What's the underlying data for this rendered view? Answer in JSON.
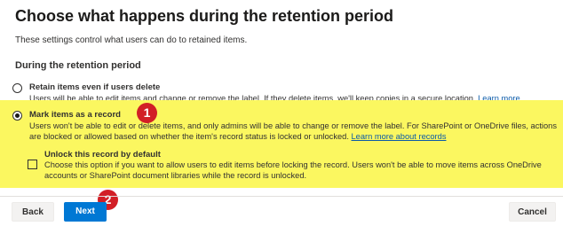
{
  "page": {
    "title": "Choose what happens during the retention period",
    "description": "These settings control what users can do to retained items.",
    "section_heading": "During the retention period"
  },
  "options": {
    "retain": {
      "label": "Retain items even if users delete",
      "description": "Users will be able to edit items and change or remove the label. If they delete items, we'll keep copies in a secure location.",
      "link": "Learn more",
      "selected": false
    },
    "record": {
      "label": "Mark items as a record",
      "description": "Users won't be able to edit or delete items, and only admins will be able to change or remove the label. For SharePoint or OneDrive files, actions are blocked or allowed based on whether the item's record status is locked or unlocked.",
      "link": "Learn more about records",
      "selected": true
    },
    "unlock": {
      "label": "Unlock this record by default",
      "description": "Choose this option if you want to allow users to edit items before locking the record. Users won't be able to move items across OneDrive accounts or SharePoint document libraries while the record is unlocked.",
      "checked": false
    }
  },
  "annotations": {
    "step1": "1",
    "step2": "2"
  },
  "buttons": {
    "back": "Back",
    "next": "Next",
    "cancel": "Cancel"
  },
  "colors": {
    "highlight": "#fbf760",
    "primary": "#0078d4",
    "link": "#0b5ba8",
    "badge": "#d21f26"
  }
}
